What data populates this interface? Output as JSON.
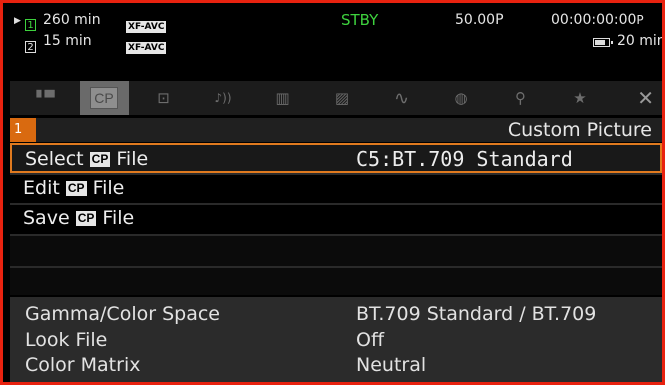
{
  "status": {
    "media": [
      {
        "slot": "1",
        "active": true,
        "time": "260 min",
        "format": "XF-AVC"
      },
      {
        "slot": "2",
        "active": false,
        "time": "15 min",
        "format": "XF-AVC"
      }
    ],
    "rec_state": "STBY",
    "frame_rate": "50.00P",
    "timecode": "00:00:00:00",
    "timecode_suffix": "P",
    "battery_time": "20 min",
    "colors": {
      "active": "#3ed23e",
      "frame": "#e8220f",
      "highlight": "#e07a1f"
    }
  },
  "tabs": [
    {
      "icon": "camera-icon",
      "glyph": "▘▀"
    },
    {
      "icon": "cp-icon",
      "glyph": "CP",
      "active": true
    },
    {
      "icon": "camera-settings-icon",
      "glyph": "⊡"
    },
    {
      "icon": "audio-icon",
      "glyph": "♪))"
    },
    {
      "icon": "film-icon",
      "glyph": "▥"
    },
    {
      "icon": "display-icon",
      "glyph": "▨"
    },
    {
      "icon": "waveform-icon",
      "glyph": "∿"
    },
    {
      "icon": "recording-media-icon",
      "glyph": "◍"
    },
    {
      "icon": "wrench-icon",
      "glyph": "⚲"
    },
    {
      "icon": "star-icon",
      "glyph": "★"
    }
  ],
  "close_glyph": "✕",
  "page": {
    "number": "1",
    "title": "Custom Picture"
  },
  "menu": {
    "select": {
      "label_pre": "Select",
      "badge": "CP",
      "label_post": "File",
      "value": "C5:BT.709 Standard"
    },
    "edit": {
      "label_pre": "Edit",
      "badge": "CP",
      "label_post": "File"
    },
    "save": {
      "label_pre": "Save",
      "badge": "CP",
      "label_post": "File"
    }
  },
  "info": [
    {
      "label": "Gamma/Color Space",
      "value": "BT.709 Standard / BT.709"
    },
    {
      "label": "Look File",
      "value": "Off"
    },
    {
      "label": "Color Matrix",
      "value": "Neutral"
    }
  ]
}
